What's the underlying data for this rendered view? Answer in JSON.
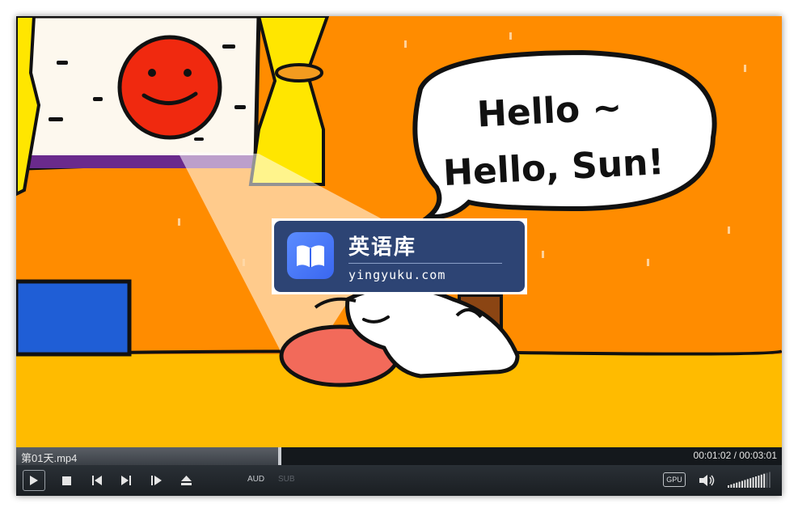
{
  "video": {
    "speech_line1": "Hello ~",
    "speech_line2": "Hello, Sun!"
  },
  "watermark": {
    "title": "英语库",
    "subtitle": "yingyuku.com",
    "icon": "open-book-icon"
  },
  "infobar": {
    "filename": "第01天.mp4",
    "current_time": "00:01:02",
    "total_time": "00:03:01",
    "time_separator": " / ",
    "progress_fraction": 0.344
  },
  "controls": {
    "audio_label": "AUD",
    "subtitle_label": "SUB",
    "gpu_label": "GPU",
    "volume_level": 0.85,
    "icons": [
      "play-icon",
      "stop-icon",
      "previous-icon",
      "next-icon",
      "frame-step-icon",
      "eject-icon",
      "speaker-icon"
    ]
  },
  "colors": {
    "wall": "#ff8c00",
    "floor": "#ffbb00",
    "watermark_bg": "#2d4474",
    "accent": "#3a67f0"
  }
}
